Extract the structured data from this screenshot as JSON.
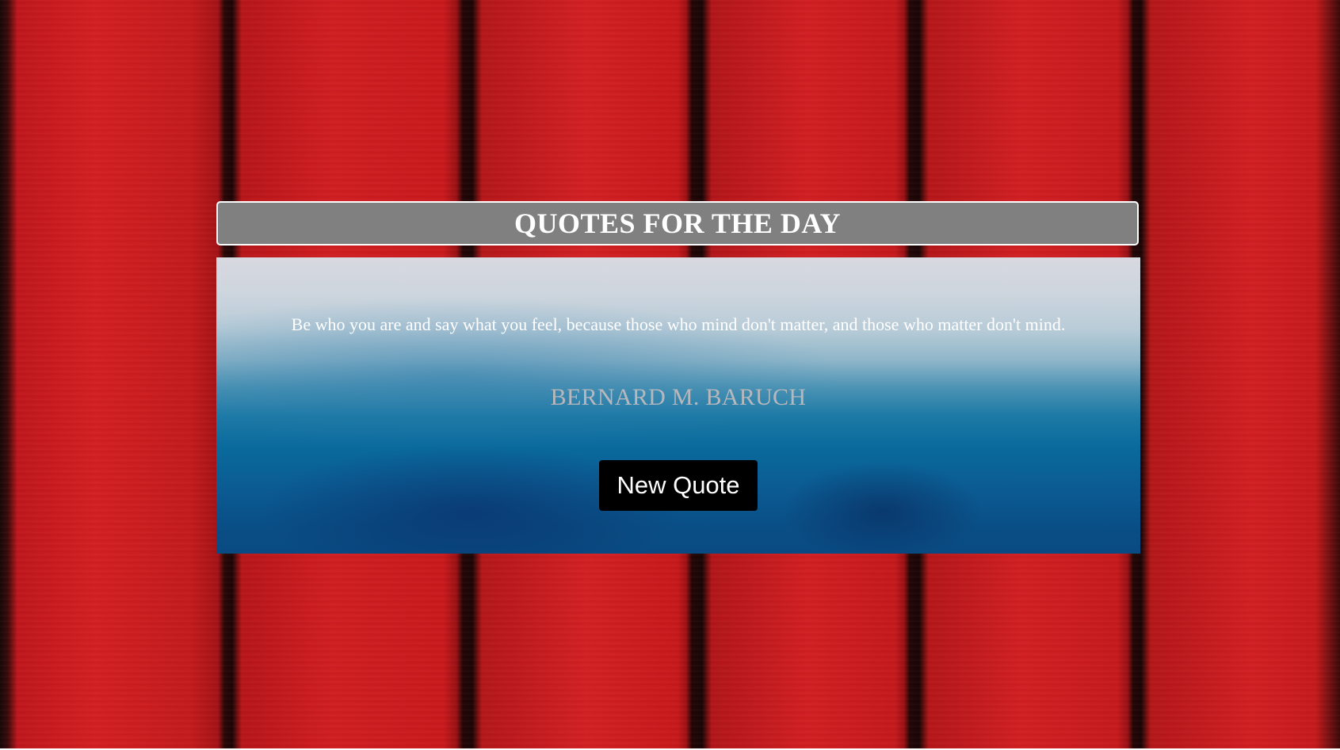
{
  "header": {
    "title": "QUOTES FOR THE DAY"
  },
  "quote": {
    "text": "Be who you are and say what you feel, because those who mind don't matter, and those who matter don't mind.",
    "author": "BERNARD M. BARUCH"
  },
  "actions": {
    "new_quote_label": "New Quote"
  },
  "colors": {
    "background_accent": "#d21e22",
    "title_bar": "#808080",
    "button": "#000000",
    "author_text": "#b8b8bc"
  }
}
